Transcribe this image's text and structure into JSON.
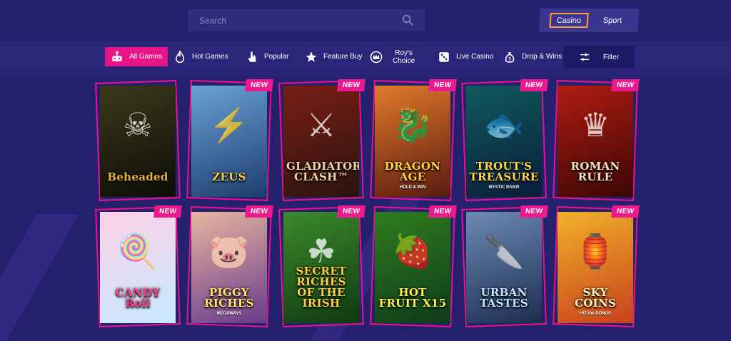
{
  "search": {
    "placeholder": "Search"
  },
  "mode": {
    "casino": "Casino",
    "sport": "Sport"
  },
  "nav": [
    {
      "label": "All Games",
      "icon": "joystick-icon",
      "active": true
    },
    {
      "label": "Hot Games",
      "icon": "flame-icon"
    },
    {
      "label": "Popular",
      "icon": "hand-pointer-icon"
    },
    {
      "label": "Feature Buy",
      "icon": "star-icon"
    },
    {
      "label_line1": "Roy's",
      "label_line2": "Choice",
      "icon": "crown-icon"
    },
    {
      "label": "Live Casino",
      "icon": "dice-icon"
    },
    {
      "label": "Drop & Wins",
      "icon": "money-bag-icon"
    }
  ],
  "filter": {
    "label": "Filter",
    "icon": "sliders-icon"
  },
  "badge_text": "NEW",
  "games": [
    {
      "title": "Beheaded",
      "subtitle": "",
      "new": false,
      "bg": [
        "#3b3a1c",
        "#0d0c07"
      ],
      "text_color": "#e6b53a",
      "glyph": "☠"
    },
    {
      "title": "ZEUS",
      "subtitle": "",
      "new": true,
      "bg": [
        "#6aa2d6",
        "#1d3d6e"
      ],
      "text_color": "#f2c94c",
      "glyph": "⚡"
    },
    {
      "title": "GLADIATOR CLASH™",
      "subtitle": "",
      "new": true,
      "bg": [
        "#7a1e14",
        "#2a1410"
      ],
      "text_color": "#e9d6a3",
      "glyph": "⚔"
    },
    {
      "title": "DRAGON AGE",
      "subtitle": "HOLD & WIN",
      "new": true,
      "bg": [
        "#e07a2a",
        "#5a1a10"
      ],
      "text_color": "#ffcf3e",
      "glyph": "🐉"
    },
    {
      "title": "TROUT'S TREASURE",
      "subtitle": "MYSTIC RIVER",
      "new": true,
      "bg": [
        "#0f5a5c",
        "#0a1d3b"
      ],
      "text_color": "#ffd54a",
      "glyph": "🐟"
    },
    {
      "title": "ROMAN RULE",
      "subtitle": "",
      "new": true,
      "bg": [
        "#b01c12",
        "#3b0705"
      ],
      "text_color": "#f4e4c0",
      "glyph": "♛"
    },
    {
      "title": "CANDY Roll",
      "subtitle": "",
      "new": true,
      "bg": [
        "#ffd1e6",
        "#c5e9ff"
      ],
      "text_color": "#ff3d8b",
      "glyph": "🍭"
    },
    {
      "title": "PIGGY RICHES",
      "subtitle": "MEGAWAYS",
      "new": true,
      "bg": [
        "#e6b6a0",
        "#6a3a8c"
      ],
      "text_color": "#ffe36a",
      "glyph": "🐷"
    },
    {
      "title": "SECRET RICHES OF THE IRISH",
      "subtitle": "",
      "new": true,
      "bg": [
        "#3b8a2a",
        "#0f3a12"
      ],
      "text_color": "#ffcf3e",
      "glyph": "☘"
    },
    {
      "title": "HOT FRUIT X15",
      "subtitle": "",
      "new": true,
      "bg": [
        "#2e7d1f",
        "#0e3b1a"
      ],
      "text_color": "#fff04a",
      "glyph": "🍓"
    },
    {
      "title": "URBAN TASTES",
      "subtitle": "",
      "new": true,
      "bg": [
        "#6d8ab5",
        "#1b2e4f"
      ],
      "text_color": "#bfe3ff",
      "glyph": "🔪"
    },
    {
      "title": "SKY COINS",
      "subtitle": "HIT the BONUS",
      "new": true,
      "bg": [
        "#f2b12a",
        "#c8411c"
      ],
      "text_color": "#fff3c4",
      "glyph": "🏮"
    }
  ],
  "colors": {
    "background": "#25206e",
    "accent_pink": "#e8148a",
    "casino_outline": "#f7a233"
  }
}
